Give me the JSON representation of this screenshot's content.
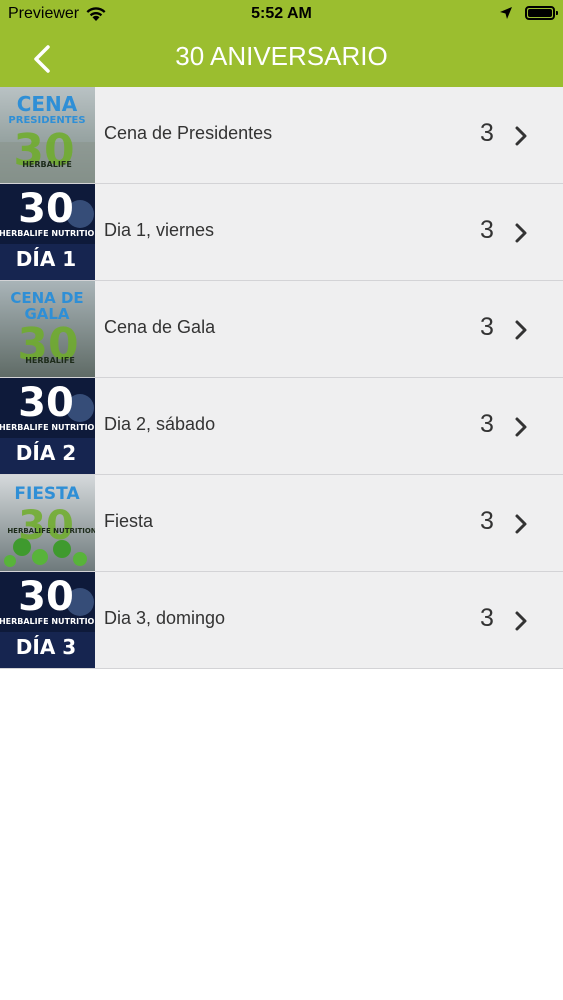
{
  "status_bar": {
    "carrier": "Previewer",
    "time": "5:52 AM"
  },
  "nav": {
    "title": "30 ANIVERSARIO",
    "back_icon": "chevron-left-icon"
  },
  "colors": {
    "accent": "#9bbe2f",
    "row_bg": "#efeff0",
    "separator": "#d3d3d6",
    "text": "#333333"
  },
  "rows": [
    {
      "label": "Cena de Presidentes",
      "count": "3",
      "thumb_text": "CENA",
      "thumb_sub": "PRESIDENTES",
      "thumb_brand": "HERBALIFE"
    },
    {
      "label": "Dia 1, viernes",
      "count": "3",
      "thumb_text": "DÍA 1",
      "thumb_brand": "HERBALIFE NUTRITION"
    },
    {
      "label": "Cena de Gala",
      "count": "3",
      "thumb_text": "CENA DE",
      "thumb_sub": "GALA",
      "thumb_brand": "HERBALIFE"
    },
    {
      "label": "Dia 2, sábado",
      "count": "3",
      "thumb_text": "DÍA 2",
      "thumb_brand": "HERBALIFE NUTRITION"
    },
    {
      "label": "Fiesta",
      "count": "3",
      "thumb_text": "FIESTA",
      "thumb_brand": "HERBALIFE NUTRITION"
    },
    {
      "label": "Dia 3, domingo",
      "count": "3",
      "thumb_text": "DÍA 3",
      "thumb_brand": "HERBALIFE NUTRITION"
    }
  ]
}
